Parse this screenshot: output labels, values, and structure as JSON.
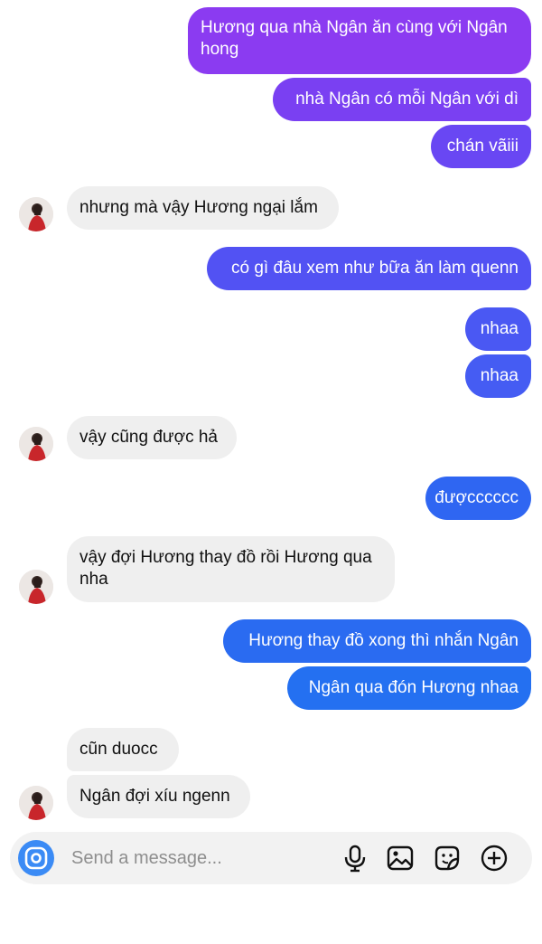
{
  "app": {
    "accent_outgoing_top": "#8a3cf0",
    "accent_outgoing_bottom": "#1f6ff0",
    "incoming_bubble": "#efefef"
  },
  "messages": [
    {
      "sender": "me",
      "text": "Hương qua nhà Ngân ăn cùng với Ngân hong"
    },
    {
      "sender": "me",
      "text": "nhà Ngân có mỗi Ngân với dì"
    },
    {
      "sender": "me",
      "text": "chán vãiii"
    },
    {
      "sender": "them",
      "text": "nhưng mà vậy Hương ngại lắm"
    },
    {
      "sender": "me",
      "text": "có gì đâu xem như bữa ăn làm quenn"
    },
    {
      "sender": "me",
      "text": "nhaa"
    },
    {
      "sender": "me",
      "text": "nhaa"
    },
    {
      "sender": "them",
      "text": "vậy cũng được hả"
    },
    {
      "sender": "me",
      "text": "đượcccccc"
    },
    {
      "sender": "them",
      "text": "vậy đợi Hương thay đồ rồi Hương qua nha"
    },
    {
      "sender": "me",
      "text": "Hương thay đồ xong thì nhắn Ngân"
    },
    {
      "sender": "me",
      "text": "Ngân qua đón Hương nhaa"
    },
    {
      "sender": "them",
      "text": "cũn duocc"
    },
    {
      "sender": "them",
      "text": "Ngân đợi xíu ngenn"
    }
  ],
  "composer": {
    "placeholder": "Send a message...",
    "icons": [
      "camera-icon",
      "microphone-icon",
      "gallery-icon",
      "sticker-icon",
      "plus-icon"
    ]
  }
}
